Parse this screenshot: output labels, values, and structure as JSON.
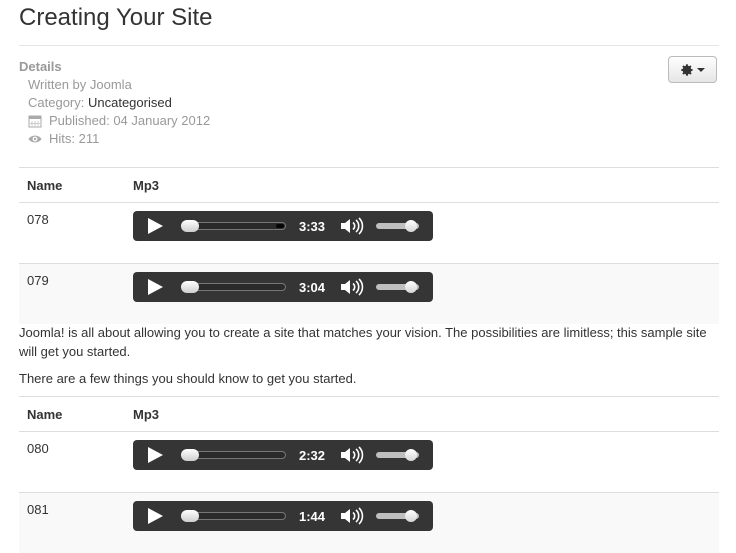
{
  "article": {
    "title": "Creating Your Site"
  },
  "details": {
    "label": "Details",
    "written_by": "Written by Joomla",
    "category_prefix": "Category: ",
    "category": "Uncategorised",
    "published": "Published: 04 January 2012",
    "hits": "Hits: 211"
  },
  "tools": {
    "icon": "gear-icon"
  },
  "tables": [
    {
      "headers": {
        "name": "Name",
        "mp3": "Mp3"
      },
      "rows": [
        {
          "name": "078",
          "time": "3:33",
          "progress": 0.0,
          "buffered": 0.08,
          "volume": 0.8
        },
        {
          "name": "079",
          "time": "3:04",
          "progress": 0.0,
          "buffered": 0.0,
          "volume": 0.8
        }
      ]
    },
    {
      "headers": {
        "name": "Name",
        "mp3": "Mp3"
      },
      "rows": [
        {
          "name": "080",
          "time": "2:32",
          "progress": 0.0,
          "buffered": 0.0,
          "volume": 0.8
        },
        {
          "name": "081",
          "time": "1:44",
          "progress": 0.0,
          "buffered": 0.0,
          "volume": 0.8
        }
      ]
    }
  ],
  "body": {
    "para1": "Joomla! is all about allowing you to create a site that matches your vision. The possibilities are limitless; this sample site will get you started.",
    "para2": "There are a few things you should know to get you started."
  },
  "colors": {
    "player_bg": "#353535",
    "border": "#dddddd",
    "muted_text": "#999999"
  }
}
